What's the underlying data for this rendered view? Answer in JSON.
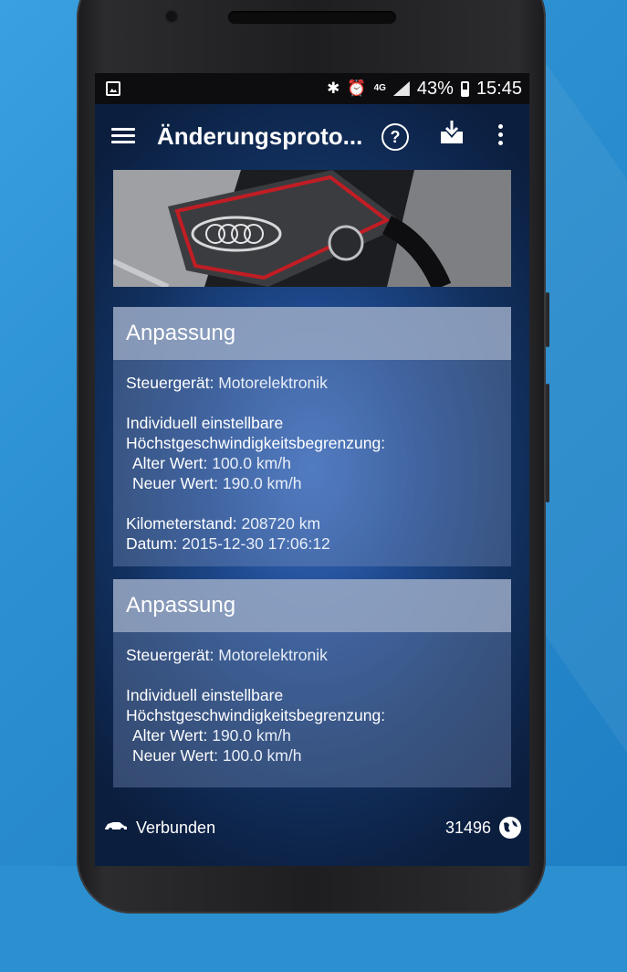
{
  "status_bar": {
    "icons": [
      "image-icon",
      "bluetooth-icon",
      "alarm-icon",
      "4g-icon",
      "signal-icon",
      "battery-icon"
    ],
    "network": "4G",
    "battery": "43%",
    "time": "15:45"
  },
  "app_bar": {
    "title": "Änderungsproto...",
    "icons": [
      "menu-icon",
      "help-icon",
      "download-icon",
      "more-icon"
    ]
  },
  "header_image": {
    "alt_icon": "engine-photo"
  },
  "cards": [
    {
      "title": "Anpassung",
      "steuergeraet_label": "Steuergerät:",
      "steuergeraet_value": "Motorelektronik",
      "line1": "Individuell einstellbare",
      "line2": "Höchstgeschwindigkeitsbegrenzung:",
      "alter_label": "Alter Wert:",
      "alter_value": "100.0 km/h",
      "neuer_label": "Neuer Wert:",
      "neuer_value": "190.0 km/h",
      "km_label": "Kilometerstand:",
      "km_value": "208720 km",
      "datum_label": "Datum:",
      "datum_value": "2015-12-30 17:06:12"
    },
    {
      "title": "Anpassung",
      "steuergeraet_label": "Steuergerät:",
      "steuergeraet_value": "Motorelektronik",
      "line1": "Individuell einstellbare",
      "line2": "Höchstgeschwindigkeitsbegrenzung:",
      "alter_label": "Alter Wert:",
      "alter_value": "190.0 km/h",
      "neuer_label": "Neuer Wert:",
      "neuer_value": "100.0 km/h"
    }
  ],
  "bottom_bar": {
    "connection": "Verbunden",
    "count": "31496"
  },
  "colors": {
    "background": "#2b8fd0",
    "screen_center": "#3a6fc4",
    "screen_edge": "#0b1e3e"
  }
}
